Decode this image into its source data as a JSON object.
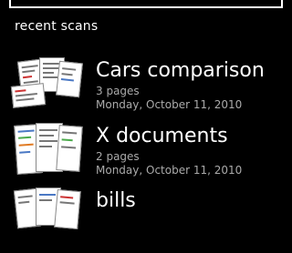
{
  "header": {
    "section_title": "recent scans"
  },
  "scans": [
    {
      "title": "Cars comparison",
      "pages": "3 pages",
      "date": "Monday, October 11, 2010"
    },
    {
      "title": "X documents",
      "pages": "2 pages",
      "date": "Monday, October 11, 2010"
    },
    {
      "title": "bills"
    }
  ],
  "colors": {
    "background": "#000000",
    "text": "#ffffff",
    "secondary_text": "#aaaaaa"
  }
}
